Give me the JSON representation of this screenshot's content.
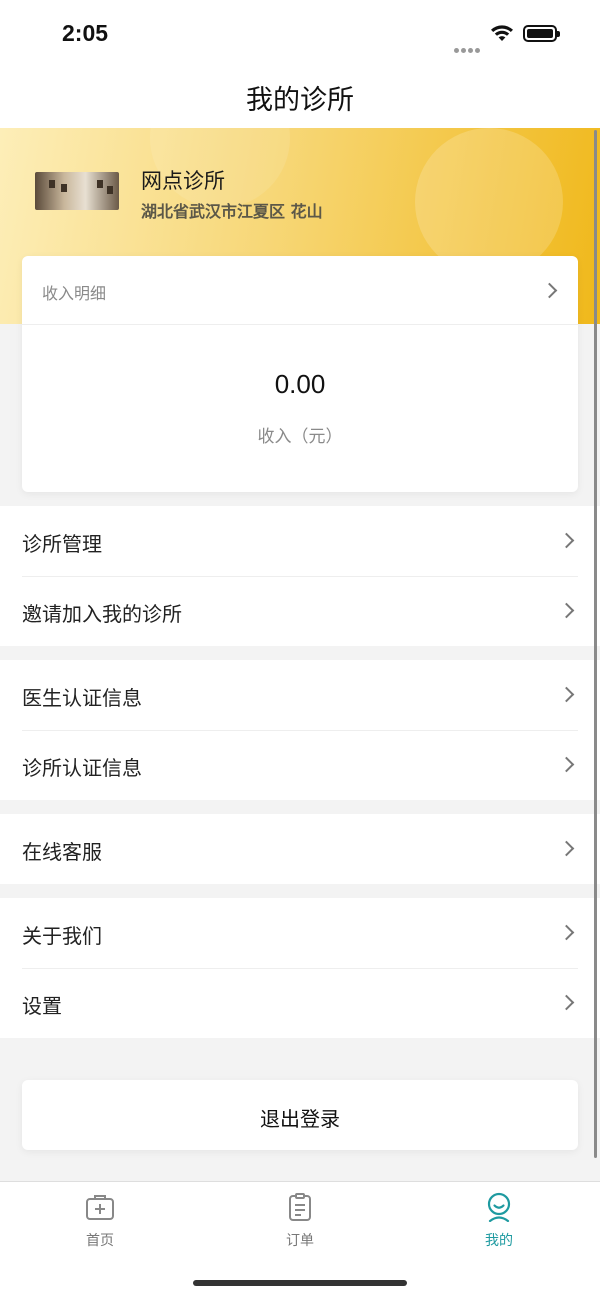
{
  "status_bar": {
    "time": "2:05"
  },
  "nav": {
    "title": "我的诊所"
  },
  "clinic": {
    "name": "网点诊所",
    "address": "湖北省武汉市江夏区 花山"
  },
  "income": {
    "header_label": "收入明细",
    "value": "0.00",
    "label": "收入（元）"
  },
  "menu": {
    "clinic_management": "诊所管理",
    "invite": "邀请加入我的诊所",
    "doctor_cert": "医生认证信息",
    "clinic_cert": "诊所认证信息",
    "customer_service": "在线客服",
    "about": "关于我们",
    "settings": "设置"
  },
  "logout": {
    "label": "退出登录"
  },
  "tabs": {
    "home": "首页",
    "orders": "订单",
    "mine": "我的"
  },
  "colors": {
    "accent": "#1e9aa0",
    "hero_start": "#fdeeb8",
    "hero_end": "#f0b81a"
  }
}
